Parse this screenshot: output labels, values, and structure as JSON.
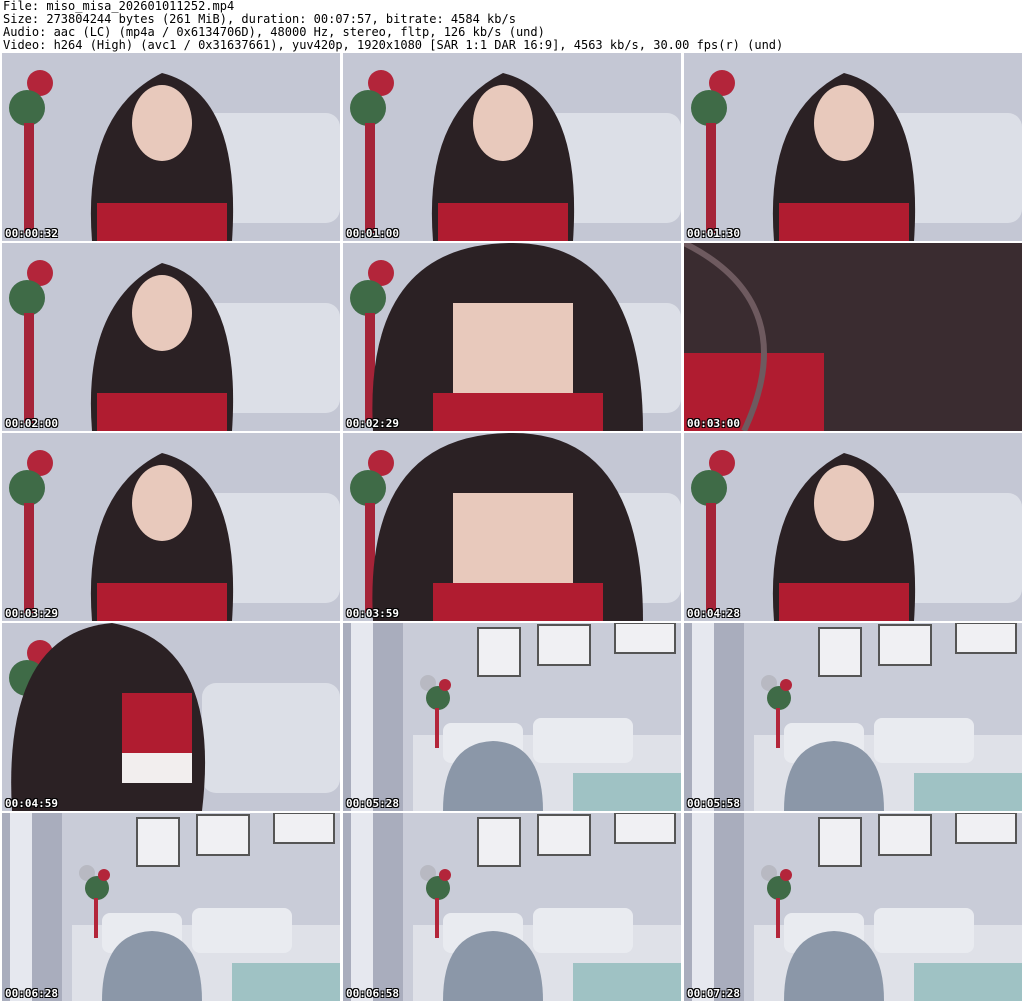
{
  "header": {
    "file": "File: miso_misa_202601011252.mp4",
    "size": "Size: 273804244 bytes (261 MiB), duration: 00:07:57, bitrate: 4584 kb/s",
    "audio": "Audio: aac (LC) (mp4a / 0x6134706D), 48000 Hz, stereo, fltp, 126 kb/s (und)",
    "video": "Video: h264 (High) (avc1 / 0x31637661), yuv420p, 1920x1080 [SAR 1:1 DAR 16:9], 4563 kb/s, 30.00 fps(r) (und)"
  },
  "thumbnails": [
    {
      "time": "00:00:32",
      "scene": "person"
    },
    {
      "time": "00:01:00",
      "scene": "person"
    },
    {
      "time": "00:01:30",
      "scene": "person"
    },
    {
      "time": "00:02:00",
      "scene": "person"
    },
    {
      "time": "00:02:29",
      "scene": "closeup"
    },
    {
      "time": "00:03:00",
      "scene": "hair"
    },
    {
      "time": "00:03:29",
      "scene": "person"
    },
    {
      "time": "00:03:59",
      "scene": "closeup"
    },
    {
      "time": "00:04:28",
      "scene": "person"
    },
    {
      "time": "00:04:59",
      "scene": "standing"
    },
    {
      "time": "00:05:28",
      "scene": "room"
    },
    {
      "time": "00:05:58",
      "scene": "room"
    },
    {
      "time": "00:06:28",
      "scene": "room"
    },
    {
      "time": "00:06:58",
      "scene": "room"
    },
    {
      "time": "00:07:28",
      "scene": "room"
    }
  ]
}
